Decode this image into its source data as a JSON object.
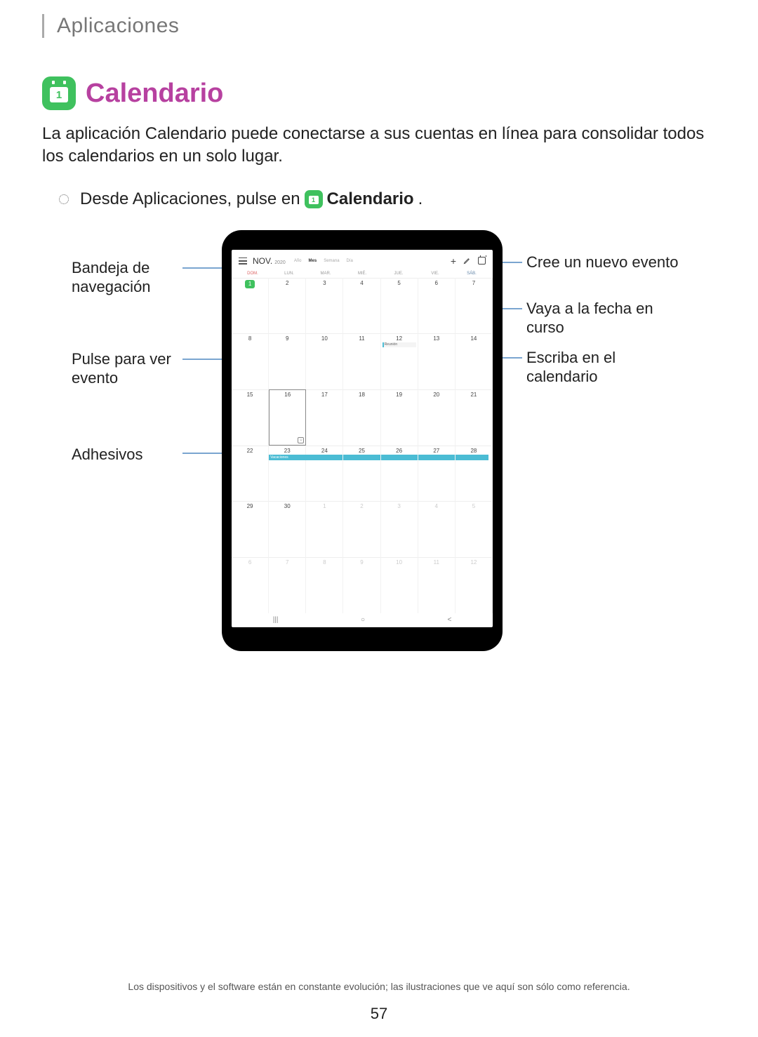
{
  "header": {
    "section": "Aplicaciones"
  },
  "app": {
    "icon_day": "1",
    "name": "Calendario",
    "intro": "La aplicación Calendario puede conectarse a sus cuentas en línea para consolidar todos los calendarios en un solo lugar.",
    "instruction_prefix": "Desde Aplicaciones, pulse en",
    "instruction_app": "Calendario",
    "instruction_suffix": "."
  },
  "callouts": {
    "nav_drawer": "Bandeja de navegación",
    "tap_view_event": "Pulse para ver evento",
    "stickers": "Adhesivos",
    "create_event": "Cree un nuevo evento",
    "goto_today": "Vaya a la fecha en curso",
    "write_calendar": "Escriba en el calendario"
  },
  "calendar": {
    "month": "NOV.",
    "year": "2020",
    "views": {
      "year": "Año",
      "month": "Mes",
      "week": "Semana",
      "day": "Día"
    },
    "weekdays": [
      "DOM.",
      "LUN.",
      "MAR.",
      "MIÉ.",
      "JUE.",
      "VIE.",
      "SÁB."
    ],
    "event_label": "Reunión",
    "banner_label": "Vacaciones",
    "rows": [
      [
        "1",
        "2",
        "3",
        "4",
        "5",
        "6",
        "7"
      ],
      [
        "8",
        "9",
        "10",
        "11",
        "12",
        "13",
        "14"
      ],
      [
        "15",
        "16",
        "17",
        "18",
        "19",
        "20",
        "21"
      ],
      [
        "22",
        "23",
        "24",
        "25",
        "26",
        "27",
        "28"
      ],
      [
        "29",
        "30",
        "1",
        "2",
        "3",
        "4",
        "5"
      ],
      [
        "6",
        "7",
        "8",
        "9",
        "10",
        "11",
        "12"
      ]
    ]
  },
  "footer": {
    "note": "Los dispositivos y el software están en constante evolución; las ilustraciones que ve aquí son sólo como referencia.",
    "page": "57"
  }
}
